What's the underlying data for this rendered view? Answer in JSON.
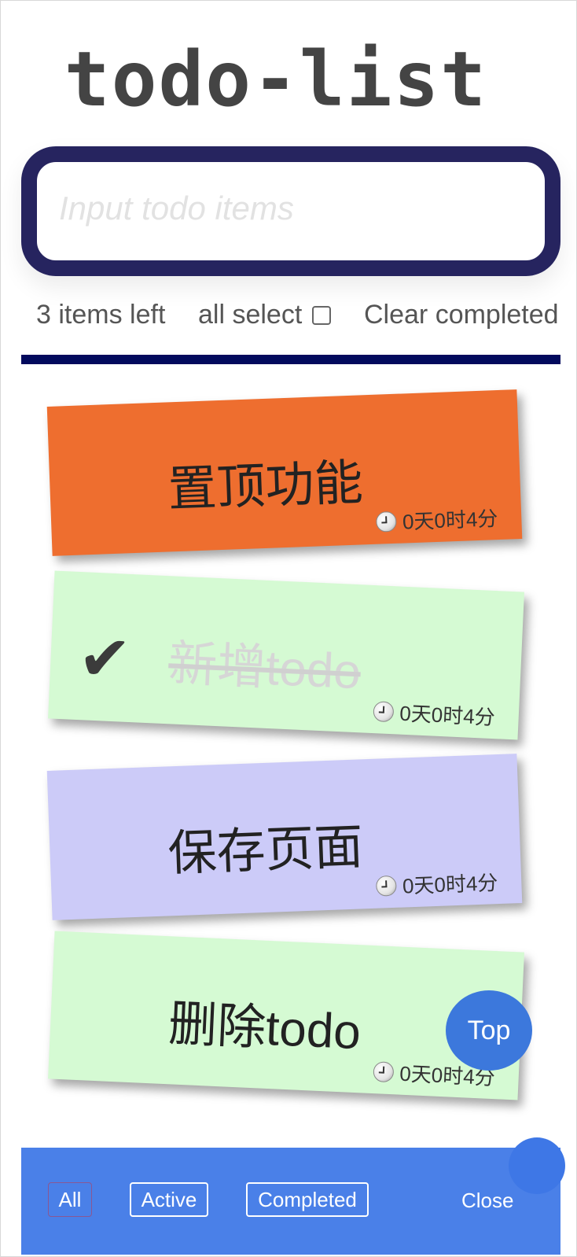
{
  "app": {
    "title": "todo-list"
  },
  "input": {
    "placeholder": "Input todo items",
    "value": ""
  },
  "stats": {
    "items_left": "3 items left",
    "all_select_label": "all select",
    "all_select_checked": false,
    "clear_label": "Clear completed"
  },
  "todos": [
    {
      "text": "置顶功能",
      "completed": false,
      "duration": "0天0时4分",
      "color": "#ee6e2f"
    },
    {
      "text": "新增todo",
      "completed": true,
      "duration": "0天0时4分",
      "color": "#d5fad3",
      "check_icon": "✔"
    },
    {
      "text": "保存页面",
      "completed": false,
      "duration": "0天0时4分",
      "color": "#cccbf8"
    },
    {
      "text": "删除todo",
      "completed": false,
      "duration": "0天0时4分",
      "color": "#d5fad3"
    }
  ],
  "top_button": {
    "label": "Top",
    "color": "#3c78dc"
  },
  "footer": {
    "filters": [
      "All",
      "Active",
      "Completed"
    ],
    "close_label": "Close",
    "color": "#4a80e8"
  },
  "colors": {
    "input_border": "#26245f",
    "divider": "#020a5d"
  }
}
